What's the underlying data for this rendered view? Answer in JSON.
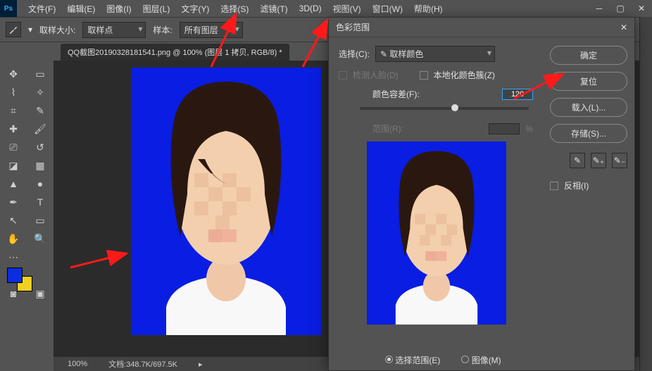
{
  "app": {
    "logo": "Ps"
  },
  "menu": {
    "file": "文件(F)",
    "edit": "编辑(E)",
    "image": "图像(I)",
    "layer": "图层(L)",
    "type": "文字(Y)",
    "select": "选择(S)",
    "filter": "滤镜(T)",
    "threed": "3D(D)",
    "view": "视图(V)",
    "window": "窗口(W)",
    "help": "帮助(H)"
  },
  "options": {
    "sample_size_label": "取样大小:",
    "sample_size_value": "取样点",
    "sample_label": "样本:",
    "sample_value": "所有图层"
  },
  "doc": {
    "tab": "QQ截图20190328181541.png @ 100% (图层 1 拷贝, RGB/8) *"
  },
  "status": {
    "zoom": "100%",
    "docinfo": "文档:348.7K/697.5K"
  },
  "dialog": {
    "title": "色彩范围",
    "select_label": "选择(C):",
    "select_value": "✎ 取样颜色",
    "detect_faces": "检测人脸(D)",
    "localized": "本地化颜色簇(Z)",
    "fuzziness_label": "颜色容差(F):",
    "fuzziness_value": "120",
    "range_label": "范围(R):",
    "range_unit": "%",
    "radio_selection": "选择范围(E)",
    "radio_image": "图像(M)",
    "btn_ok": "确定",
    "btn_reset": "复位",
    "btn_load": "载入(L)...",
    "btn_save": "存储(S)...",
    "invert": "反相(I)"
  },
  "colors": {
    "fg": "#0a2de0",
    "bg": "#f0d020"
  }
}
